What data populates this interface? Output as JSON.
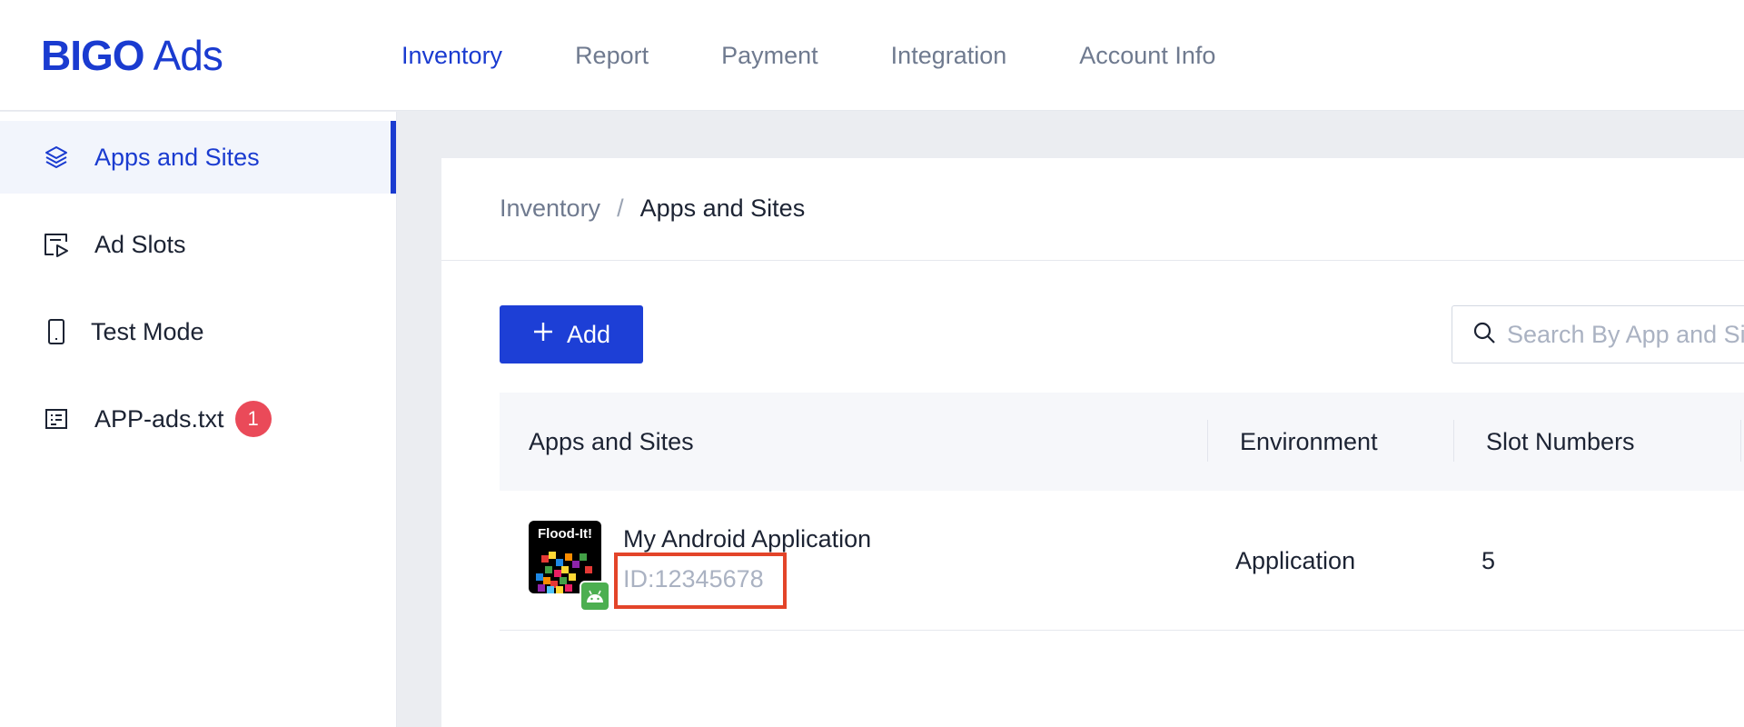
{
  "brand": {
    "logo_text": "BIGO",
    "logo_suffix": "Ads",
    "accent_color": "#1a3bd0"
  },
  "topnav": {
    "items": [
      {
        "label": "Inventory",
        "active": true
      },
      {
        "label": "Report",
        "active": false
      },
      {
        "label": "Payment",
        "active": false
      },
      {
        "label": "Integration",
        "active": false
      },
      {
        "label": "Account Info",
        "active": false
      }
    ]
  },
  "sidebar": {
    "items": [
      {
        "label": "Apps and Sites",
        "icon": "layers-icon",
        "active": true
      },
      {
        "label": "Ad Slots",
        "icon": "ad-slot-icon",
        "active": false
      },
      {
        "label": "Test Mode",
        "icon": "phone-icon",
        "active": false
      },
      {
        "label": "APP-ads.txt",
        "icon": "text-file-icon",
        "active": false,
        "badge": "1"
      }
    ]
  },
  "breadcrumb": {
    "parent": "Inventory",
    "separator": "/",
    "current": "Apps and Sites"
  },
  "toolbar": {
    "add_label": "Add",
    "search_placeholder": "Search By App and Site"
  },
  "table": {
    "columns": [
      "Apps and Sites",
      "Environment",
      "Slot Numbers"
    ],
    "rows": [
      {
        "icon_text": "Flood-It!",
        "name": "My Android Application",
        "id": "ID:12345678",
        "platform": "android-icon",
        "environment": "Application",
        "slots": "5"
      }
    ]
  },
  "colors": {
    "primary": "#1d3fd6",
    "badge": "#ea4a59",
    "highlight_box": "#e34429",
    "android": "#4caf50"
  }
}
